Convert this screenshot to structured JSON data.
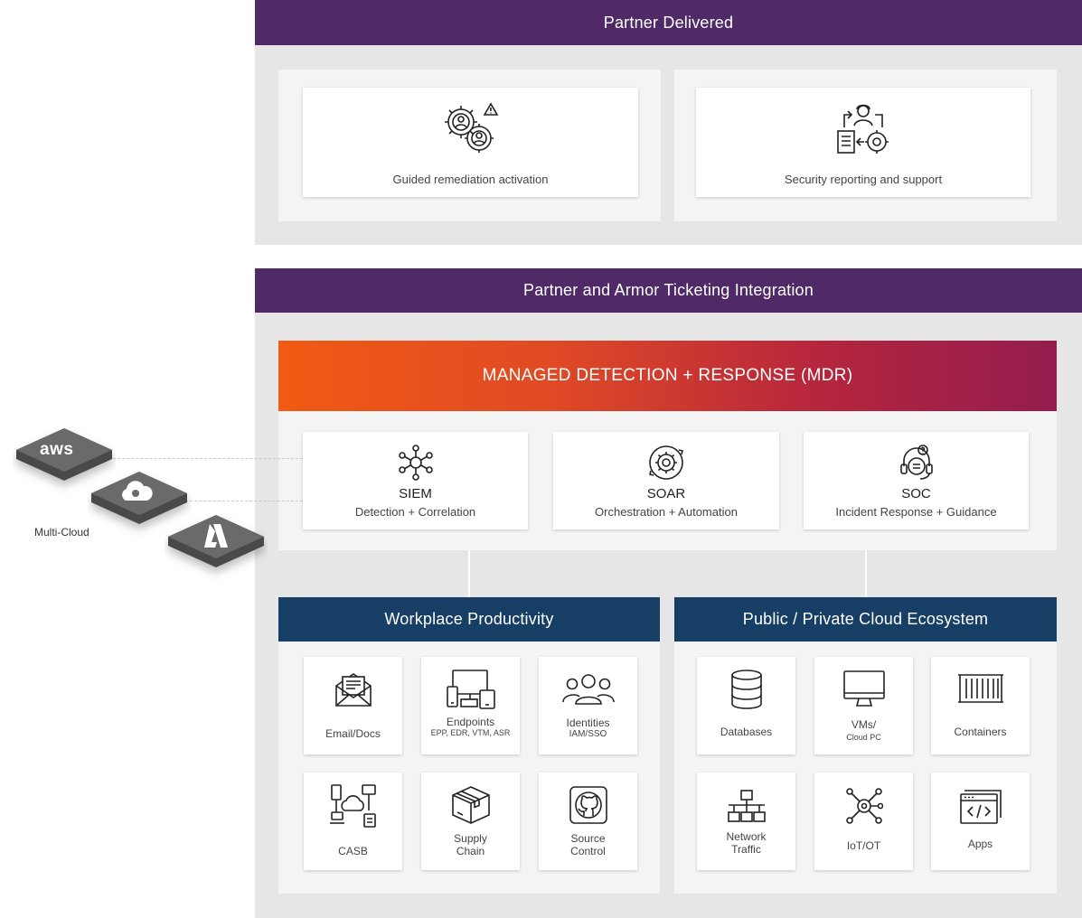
{
  "partner_delivered": {
    "title": "Partner Delivered",
    "cards": [
      {
        "label": "Guided remediation activation",
        "icon": "gears-user-warning-icon"
      },
      {
        "label": "Security reporting and support",
        "icon": "agent-report-gear-icon"
      }
    ]
  },
  "ticketing": {
    "title": "Partner and Armor Ticketing Integration"
  },
  "mdr": {
    "title": "MANAGED DETECTION + RESPONSE (MDR)",
    "services": [
      {
        "name": "SIEM",
        "desc": "Detection + Correlation",
        "icon": "network-hub-icon"
      },
      {
        "name": "SOAR",
        "desc": "Orchestration + Automation",
        "icon": "gear-cycle-icon"
      },
      {
        "name": "SOC",
        "desc": "Incident Response + Guidance",
        "icon": "headset-support-icon"
      }
    ]
  },
  "workplace": {
    "title": "Workplace Productivity",
    "tiles": [
      {
        "label": "Email/Docs",
        "sub": "",
        "icon": "envelope-icon"
      },
      {
        "label": "Endpoints",
        "sub": "EPP, EDR, VTM, ASR",
        "icon": "devices-icon"
      },
      {
        "label": "Identities",
        "sub": "IAM/SSO",
        "icon": "users-group-icon"
      },
      {
        "label": "CASB",
        "sub": "",
        "icon": "cloud-devices-icon"
      },
      {
        "label": "Supply\nChain",
        "sub": "",
        "icon": "package-box-icon"
      },
      {
        "label": "Source\nControl",
        "sub": "",
        "icon": "github-icon"
      }
    ]
  },
  "cloud_ecosystem": {
    "title": "Public / Private Cloud Ecosystem",
    "tiles": [
      {
        "label": "Databases",
        "sub": "",
        "icon": "database-icon"
      },
      {
        "label": "VMs/",
        "sub": "Cloud PC",
        "icon": "monitor-icon"
      },
      {
        "label": "Containers",
        "sub": "",
        "icon": "container-icon"
      },
      {
        "label": "Network\nTraffic",
        "sub": "",
        "icon": "network-topology-icon"
      },
      {
        "label": "IoT/OT",
        "sub": "",
        "icon": "iot-hub-icon"
      },
      {
        "label": "Apps",
        "sub": "",
        "icon": "code-window-icon"
      }
    ]
  },
  "multicloud": {
    "label": "Multi-Cloud",
    "providers": [
      {
        "name": "aws",
        "icon": "aws-logo-icon"
      },
      {
        "name": "google-cloud",
        "icon": "google-cloud-icon"
      },
      {
        "name": "azure",
        "icon": "azure-logo-icon"
      }
    ]
  },
  "colors": {
    "purple": "#4f2a67",
    "navy": "#173f66",
    "mdr_start": "#f15a13",
    "mdr_end": "#931d4f"
  }
}
